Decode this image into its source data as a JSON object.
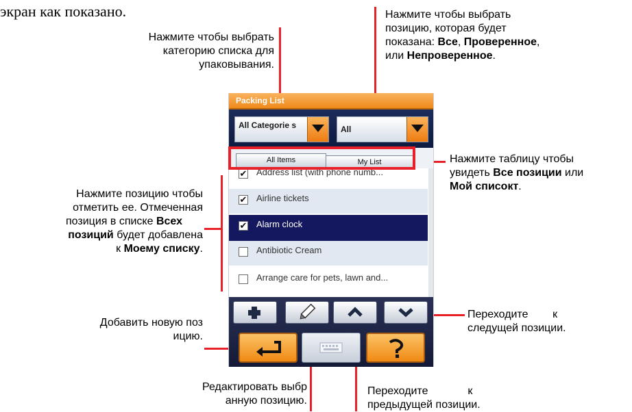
{
  "intro_text": "экран как показано.",
  "annotations": {
    "category": "Нажмите чтобы выбрать категорию списка для упаковывания.",
    "filter_html_1": "Нажмите чтобы выбрать",
    "filter_html_2": "позицию, которая будет",
    "filter_html_3": "показана: ",
    "filter_all": "Все",
    "filter_checked": "Проверенное",
    "filter_sep": ", ",
    "filter_or": "или ",
    "filter_unchecked": "Непроверенное",
    "filter_end": ".",
    "tabs_1": "Нажмите таблицу чтобы",
    "tabs_2a": "увидеть ",
    "tabs_all": "Все позиции",
    "tabs_or": " или",
    "tabs_my": "Мой списокт",
    "tabs_end": ".",
    "item_1": "Нажмите позицию чтобы",
    "item_2": "отметить ее. Отмеченная",
    "item_3a": "позиция в списке ",
    "item_all": "Всех",
    "item_all2": "позиций",
    "item_4": "  будет добавлена",
    "item_5a": "к ",
    "item_my": "Моему списку",
    "item_end": ".",
    "add_1": "Добавить новую поз",
    "add_2": "ицию.",
    "next_1": "Переходите        к",
    "next_2": "следущей позиции.",
    "edit_1": "Редактировать выбр",
    "edit_2": "анную позицию.",
    "prev_1": "Переходите             к",
    "prev_2": "предыдущей позиции."
  },
  "app": {
    "title": "Packing List",
    "category_dropdown": "All Categorie s",
    "filter_dropdown": "All",
    "tabs": [
      "All Items",
      "My List"
    ],
    "items": [
      {
        "label": "Address list (with phone numb...",
        "checked": true
      },
      {
        "label": "Airline tickets",
        "checked": true
      },
      {
        "label": "Alarm clock",
        "checked": true,
        "selected": true
      },
      {
        "label": "Antibiotic Cream",
        "checked": false
      },
      {
        "label": "Arrange care for pets, lawn and...",
        "checked": false
      }
    ],
    "buttons": [
      "add-icon",
      "edit-pencil-icon",
      "up-arrow-icon",
      "down-arrow-icon",
      "back-return-icon",
      "keyboard-icon",
      "help-icon"
    ]
  },
  "colors": {
    "accent_orange": "#f08a1a",
    "navy": "#14195f",
    "highlight_red": "#e8202a"
  }
}
